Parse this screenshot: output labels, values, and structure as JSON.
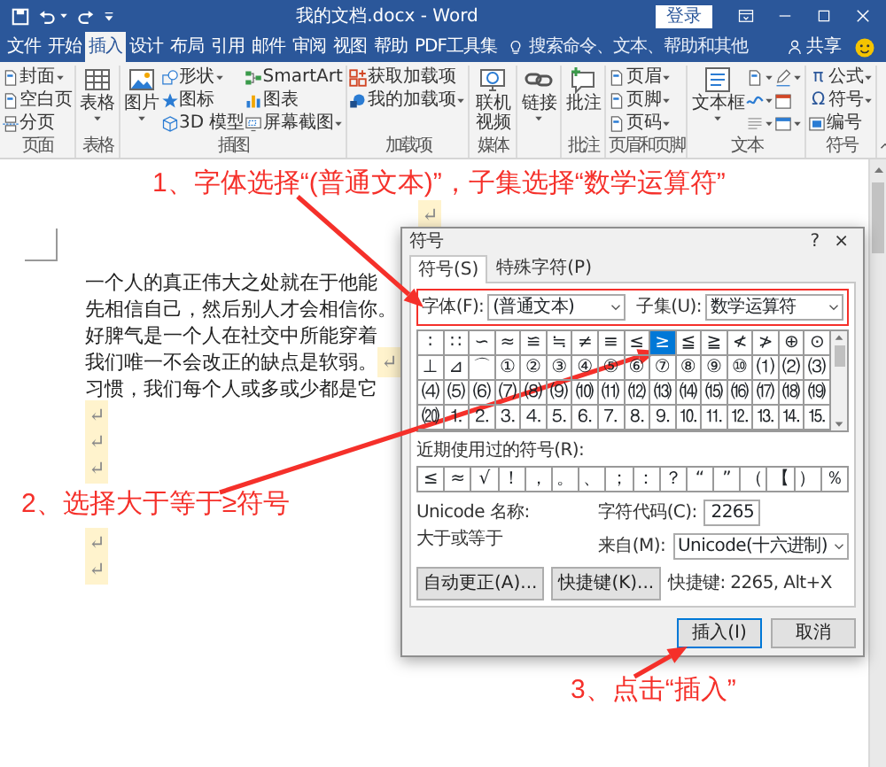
{
  "window": {
    "title": "我的文档.docx - Word",
    "sign_in": "登录"
  },
  "tabs": [
    {
      "label": "文件",
      "selected": false
    },
    {
      "label": "开始",
      "selected": false
    },
    {
      "label": "插入",
      "selected": true
    },
    {
      "label": "设计",
      "selected": false
    },
    {
      "label": "布局",
      "selected": false
    },
    {
      "label": "引用",
      "selected": false
    },
    {
      "label": "邮件",
      "selected": false
    },
    {
      "label": "审阅",
      "selected": false
    },
    {
      "label": "视图",
      "selected": false
    },
    {
      "label": "帮助",
      "selected": false
    },
    {
      "label": "PDF工具集",
      "selected": false
    }
  ],
  "tell_me": {
    "placeholder": "搜索命令、文本、帮助和其他"
  },
  "share": "共享",
  "ribbon": [
    {
      "label": "页面",
      "columns": [
        {
          "kind": "stack",
          "items": [
            {
              "label": "封面",
              "dropdown": true
            },
            {
              "label": "空白页",
              "dropdown": false
            },
            {
              "label": "分页",
              "dropdown": false
            }
          ]
        }
      ]
    },
    {
      "label": "表格",
      "columns": [
        {
          "kind": "large",
          "items": [
            {
              "label": "表格",
              "dropdown": true
            }
          ]
        }
      ]
    },
    {
      "label": "插图",
      "columns": [
        {
          "kind": "large",
          "items": [
            {
              "label": "图片",
              "dropdown": true
            }
          ]
        },
        {
          "kind": "stack",
          "items": [
            {
              "label": "形状",
              "dropdown": true
            },
            {
              "label": "图标",
              "dropdown": false
            },
            {
              "label": "3D 模型",
              "dropdown": false
            }
          ]
        },
        {
          "kind": "stack",
          "items": [
            {
              "label": "SmartArt",
              "dropdown": false
            },
            {
              "label": "图表",
              "dropdown": false
            },
            {
              "label": "屏幕截图",
              "dropdown": true
            }
          ]
        }
      ]
    },
    {
      "label": "加载项",
      "columns": [
        {
          "kind": "stack",
          "items": [
            {
              "label": "获取加载项",
              "dropdown": false
            },
            {
              "label": "我的加载项",
              "dropdown": true
            }
          ]
        }
      ]
    },
    {
      "label": "媒体",
      "columns": [
        {
          "kind": "large",
          "items": [
            {
              "label": "联机视频",
              "dropdown": false
            }
          ]
        }
      ]
    },
    {
      "columns": [
        {
          "kind": "large",
          "items": [
            {
              "label": "链接",
              "dropdown": true
            }
          ]
        }
      ]
    },
    {
      "label": "批注",
      "columns": [
        {
          "kind": "large",
          "items": [
            {
              "label": "批注",
              "dropdown": false
            }
          ]
        }
      ]
    },
    {
      "label": "页眉和页脚",
      "columns": [
        {
          "kind": "stack",
          "items": [
            {
              "label": "页眉",
              "dropdown": true
            },
            {
              "label": "页脚",
              "dropdown": true
            },
            {
              "label": "页码",
              "dropdown": true
            }
          ]
        }
      ]
    },
    {
      "label": "文本",
      "columns": [
        {
          "kind": "large",
          "items": [
            {
              "label": "文本框",
              "dropdown": true
            }
          ]
        },
        {
          "kind": "stack",
          "items": [
            {
              "dropdown": true
            },
            {
              "dropdown": true
            },
            {
              "dropdown": true
            }
          ]
        },
        {
          "kind": "stack",
          "items": [
            {
              "dropdown": true
            },
            {
              "dropdown": false
            },
            {
              "dropdown": true
            }
          ]
        }
      ]
    },
    {
      "label": "符号",
      "columns": [
        {
          "kind": "stack",
          "items": [
            {
              "glyph": "π",
              "label": "公式",
              "dropdown": true
            },
            {
              "glyph": "Ω",
              "label": "符号",
              "dropdown": true
            },
            {
              "label": "编号",
              "dropdown": false
            }
          ]
        }
      ]
    }
  ],
  "document": {
    "lines": [
      {
        "kind": "center",
        "mark": "↵"
      },
      {
        "kind": "body",
        "text": "一个人的真正伟大之处就在于他能"
      },
      {
        "kind": "body",
        "text": "先相信自己，然后别人才会相信你。"
      },
      {
        "kind": "body",
        "text": "好脾气是一个人在社交中所能穿着"
      },
      {
        "kind": "body",
        "text": "我们唯一不会改正的缺点是软弱。",
        "mark": "↵"
      },
      {
        "kind": "body",
        "text": "习惯，我们每个人或多或少都是它"
      },
      {
        "kind": "body",
        "mark": "↵"
      },
      {
        "kind": "body",
        "mark": "↵"
      },
      {
        "kind": "body",
        "mark": "↵"
      },
      {
        "kind": "body",
        "mark": "↵"
      },
      {
        "kind": "body",
        "mark": "↵"
      }
    ]
  },
  "dialog": {
    "title": "符号",
    "help": "?",
    "close": "×",
    "tabs": [
      {
        "label": "符号(S)",
        "selected": true
      },
      {
        "label": "特殊字符(P)",
        "selected": false
      }
    ],
    "font": {
      "label": "字体(F):",
      "value": "(普通文本)"
    },
    "subset": {
      "label": "子集(U):",
      "value": "数学运算符"
    },
    "symbols": [
      {
        "char": "∶",
        "selected": false
      },
      {
        "char": "∷",
        "selected": false
      },
      {
        "char": "∽",
        "selected": false
      },
      {
        "char": "≈",
        "selected": false
      },
      {
        "char": "≌",
        "selected": false
      },
      {
        "char": "≒",
        "selected": false
      },
      {
        "char": "≠",
        "selected": false
      },
      {
        "char": "≡",
        "selected": false
      },
      {
        "char": "≤",
        "selected": false
      },
      {
        "char": "≥",
        "selected": true
      },
      {
        "char": "≦",
        "selected": false
      },
      {
        "char": "≧",
        "selected": false
      },
      {
        "char": "≮",
        "selected": false
      },
      {
        "char": "≯",
        "selected": false
      },
      {
        "char": "⊕",
        "selected": false
      },
      {
        "char": "⊙",
        "selected": false
      },
      {
        "char": "⊥",
        "selected": false
      },
      {
        "char": "⊿",
        "selected": false
      },
      {
        "char": "⌒",
        "selected": false
      },
      {
        "char": "①",
        "selected": false
      },
      {
        "char": "②",
        "selected": false
      },
      {
        "char": "③",
        "selected": false
      },
      {
        "char": "④",
        "selected": false
      },
      {
        "char": "⑤",
        "selected": false
      },
      {
        "char": "⑥",
        "selected": false
      },
      {
        "char": "⑦",
        "selected": false
      },
      {
        "char": "⑧",
        "selected": false
      },
      {
        "char": "⑨",
        "selected": false
      },
      {
        "char": "⑩",
        "selected": false
      },
      {
        "char": "⑴",
        "selected": false
      },
      {
        "char": "⑵",
        "selected": false
      },
      {
        "char": "⑶",
        "selected": false
      },
      {
        "char": "⑷",
        "selected": false
      },
      {
        "char": "⑸",
        "selected": false
      },
      {
        "char": "⑹",
        "selected": false
      },
      {
        "char": "⑺",
        "selected": false
      },
      {
        "char": "⑻",
        "selected": false
      },
      {
        "char": "⑼",
        "selected": false
      },
      {
        "char": "⑽",
        "selected": false
      },
      {
        "char": "⑾",
        "selected": false
      },
      {
        "char": "⑿",
        "selected": false
      },
      {
        "char": "⒀",
        "selected": false
      },
      {
        "char": "⒁",
        "selected": false
      },
      {
        "char": "⒂",
        "selected": false
      },
      {
        "char": "⒃",
        "selected": false
      },
      {
        "char": "⒄",
        "selected": false
      },
      {
        "char": "⒅",
        "selected": false
      },
      {
        "char": "⒆",
        "selected": false
      },
      {
        "char": "⒇",
        "selected": false
      },
      {
        "char": "⒈",
        "selected": false
      },
      {
        "char": "⒉",
        "selected": false
      },
      {
        "char": "⒊",
        "selected": false
      },
      {
        "char": "⒋",
        "selected": false
      },
      {
        "char": "⒌",
        "selected": false
      },
      {
        "char": "⒍",
        "selected": false
      },
      {
        "char": "⒎",
        "selected": false
      },
      {
        "char": "⒏",
        "selected": false
      },
      {
        "char": "⒐",
        "selected": false
      },
      {
        "char": "⒑",
        "selected": false
      },
      {
        "char": "⒒",
        "selected": false
      },
      {
        "char": "⒓",
        "selected": false
      },
      {
        "char": "⒔",
        "selected": false
      },
      {
        "char": "⒕",
        "selected": false
      },
      {
        "char": "⒖",
        "selected": false
      }
    ],
    "recent_label": "近期使用过的符号(R):",
    "recent": [
      "≤",
      "≈",
      "√",
      "！",
      "，",
      "。",
      "、",
      "；",
      "：",
      "？",
      "“",
      "”",
      "（",
      "【",
      "）",
      "％"
    ],
    "unicode_name_label": "Unicode 名称:",
    "unicode_name": "大于或等于",
    "char_code": {
      "label": "字符代码(C):",
      "value": "2265"
    },
    "from": {
      "label": "来自(M):",
      "value": "Unicode(十六进制)"
    },
    "buttons": [
      "自动更正(A)...",
      "快捷键(K)..."
    ],
    "shortcut": "快捷键: 2265, Alt+X",
    "insert": "插入(I)",
    "cancel": "取消"
  },
  "annotations": [
    {
      "text": "1、字体选择“(普通文本)”，子集选择“数学运算符”"
    },
    {
      "text": "2、选择大于等于≥符号"
    },
    {
      "text": "3、点击“插入”"
    }
  ]
}
